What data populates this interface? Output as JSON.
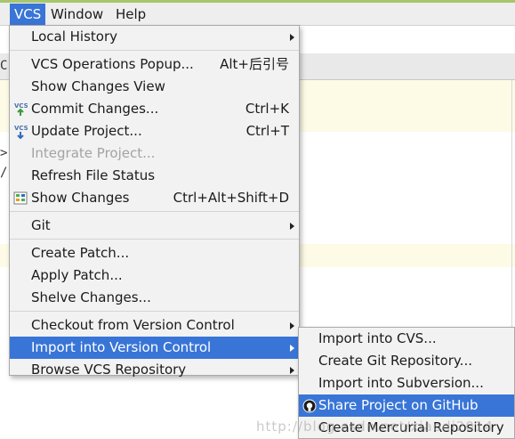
{
  "menubar": {
    "items": [
      {
        "label": "VCS",
        "active": true
      },
      {
        "label": "Window",
        "active": false
      },
      {
        "label": "Help",
        "active": false
      }
    ]
  },
  "background": {
    "marks": [
      "C",
      ">",
      "/"
    ]
  },
  "vcs_menu": {
    "groups": [
      [
        {
          "label": "Local History",
          "shortcut": "",
          "submenu": true
        }
      ],
      [
        {
          "label": "VCS Operations Popup...",
          "shortcut": "Alt+后引号"
        },
        {
          "label": "Show Changes View",
          "shortcut": ""
        },
        {
          "label": "Commit Changes...",
          "shortcut": "Ctrl+K",
          "icon": "vcs-commit-icon"
        },
        {
          "label": "Update Project...",
          "shortcut": "Ctrl+T",
          "icon": "vcs-update-icon"
        },
        {
          "label": "Integrate Project...",
          "shortcut": "",
          "disabled": true
        },
        {
          "label": "Refresh File Status",
          "shortcut": ""
        },
        {
          "label": "Show Changes",
          "shortcut": "Ctrl+Alt+Shift+D",
          "icon": "show-changes-icon"
        }
      ],
      [
        {
          "label": "Git",
          "shortcut": "",
          "submenu": true
        }
      ],
      [
        {
          "label": "Create Patch...",
          "shortcut": ""
        },
        {
          "label": "Apply Patch...",
          "shortcut": ""
        },
        {
          "label": "Shelve Changes...",
          "shortcut": ""
        }
      ],
      [
        {
          "label": "Checkout from Version Control",
          "shortcut": "",
          "submenu": true
        },
        {
          "label": "Import into Version Control",
          "shortcut": "",
          "submenu": true,
          "highlight": true
        },
        {
          "label": "Browse VCS Repository",
          "shortcut": "",
          "submenu": true
        }
      ]
    ]
  },
  "import_submenu": {
    "items": [
      {
        "label": "Import into CVS..."
      },
      {
        "label": "Create Git Repository..."
      },
      {
        "label": "Import into Subversion..."
      },
      {
        "label": "Share Project on GitHub",
        "highlight": true,
        "icon": "github-icon"
      },
      {
        "label": "Create Mercurial Repository"
      }
    ]
  },
  "watermark": {
    "text": "http://blog.csdn.net/xiaodi2014"
  },
  "colors": {
    "highlight": "#3875d7",
    "menu_bg": "#f2f2f2",
    "disabled_text": "#a3a3a3",
    "editor_yellow": "#fdfbe6"
  }
}
